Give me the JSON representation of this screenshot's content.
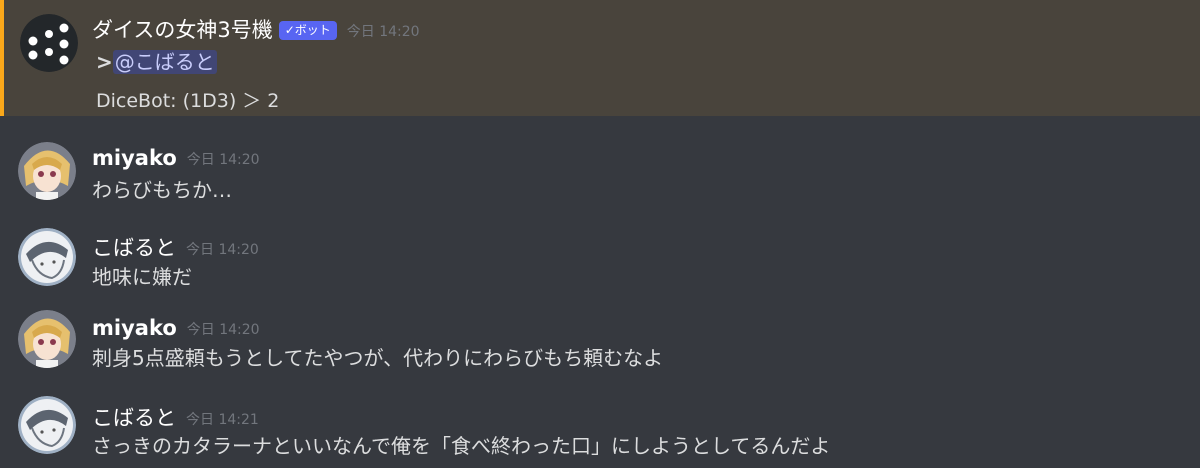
{
  "messages": [
    {
      "author": "ダイスの女神3号機",
      "bot_badge": "✓ボット",
      "timestamp": "今日 14:20",
      "quote_marker": ">",
      "mention": "@こばると",
      "result": "DiceBot: (1D3) ＞ 2",
      "avatar": "dice-icon"
    },
    {
      "author": "miyako",
      "timestamp": "今日 14:20",
      "text": "わらびもちか…",
      "avatar": "anime-girl-avatar"
    },
    {
      "author": "こばると",
      "timestamp": "今日 14:20",
      "text": "地味に嫌だ",
      "avatar": "sketch-boy-avatar"
    },
    {
      "author": "miyako",
      "timestamp": "今日 14:20",
      "text": "刺身5点盛頼もうとしてたやつが、代わりにわらびもち頼むなよ",
      "avatar": "anime-girl-avatar"
    },
    {
      "author": "こばると",
      "timestamp": "今日 14:21",
      "text": "さっきのカタラーナといいなんで俺を「食べ終わった口」にしようとしてるんだよ",
      "avatar": "sketch-boy-avatar"
    }
  ],
  "colors": {
    "background": "#36393f",
    "mention_highlight": "#49443c",
    "mention_bar": "#faa81a",
    "bot_badge": "#5865f2"
  }
}
